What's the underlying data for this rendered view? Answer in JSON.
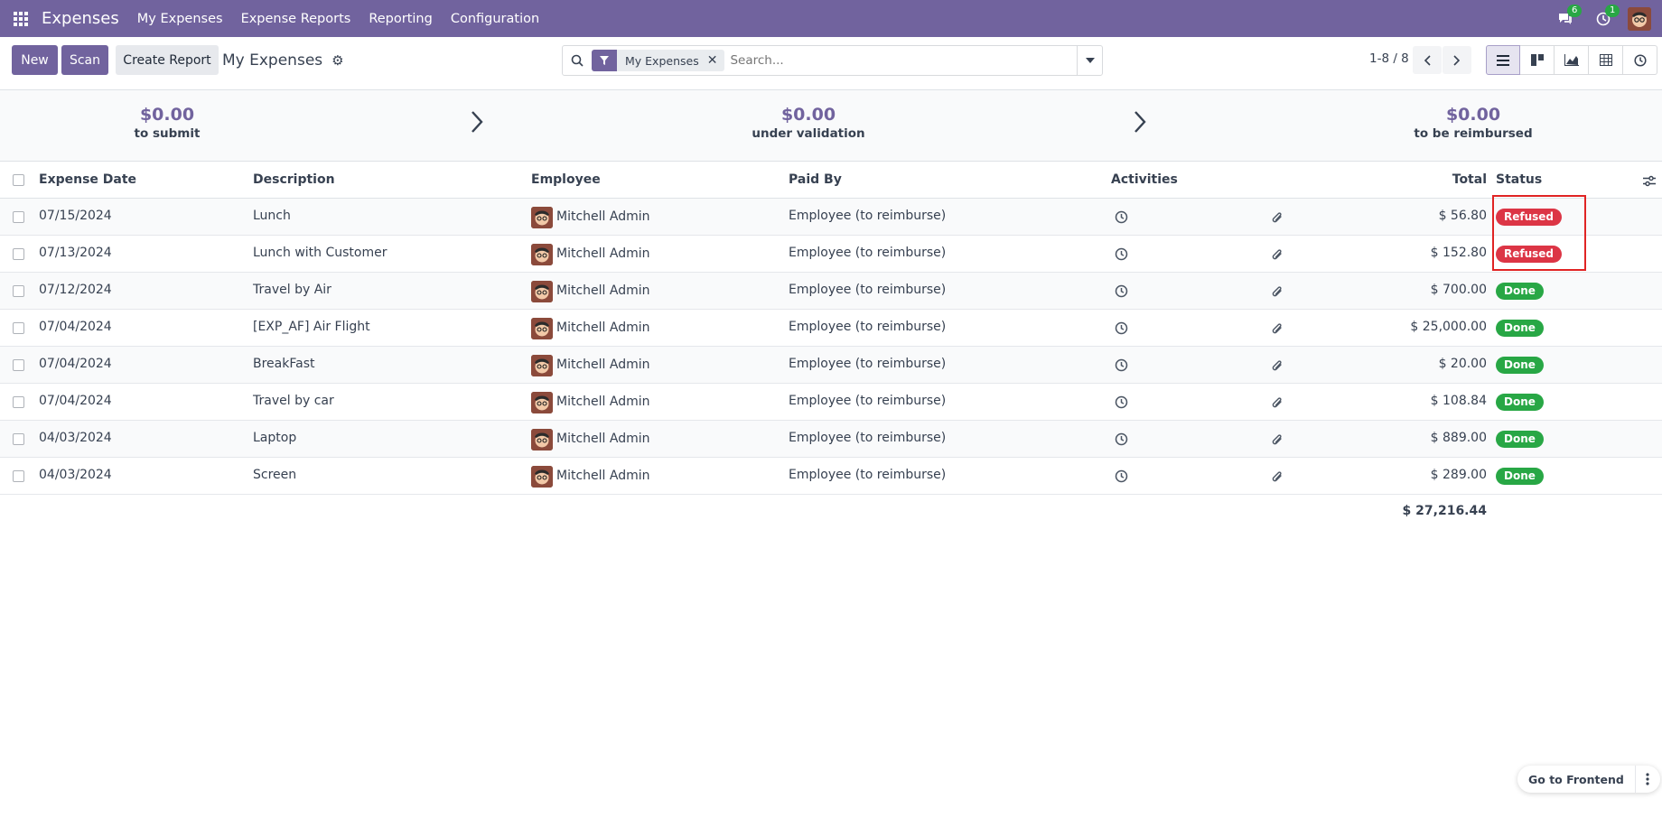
{
  "navbar": {
    "app_name": "Expenses",
    "menu": [
      "My Expenses",
      "Expense Reports",
      "Reporting",
      "Configuration"
    ],
    "messages_count": "6",
    "activities_count": "1"
  },
  "control": {
    "new_label": "New",
    "scan_label": "Scan",
    "create_report_label": "Create Report",
    "breadcrumb": "My Expenses",
    "facet_label": "My Expenses",
    "search_placeholder": "Search...",
    "pager": "1-8 / 8"
  },
  "summary": {
    "to_submit": {
      "amount": "$0.00",
      "label": "to submit"
    },
    "under_validation": {
      "amount": "$0.00",
      "label": "under validation"
    },
    "to_be_reimbursed": {
      "amount": "$0.00",
      "label": "to be reimbursed"
    }
  },
  "table": {
    "headers": {
      "date": "Expense Date",
      "description": "Description",
      "employee": "Employee",
      "paid_by": "Paid By",
      "activities": "Activities",
      "total": "Total",
      "status": "Status"
    },
    "rows": [
      {
        "date": "07/15/2024",
        "description": "Lunch",
        "employee": "Mitchell Admin",
        "paid_by": "Employee (to reimburse)",
        "total": "$ 56.80",
        "status": "Refused"
      },
      {
        "date": "07/13/2024",
        "description": "Lunch with Customer",
        "employee": "Mitchell Admin",
        "paid_by": "Employee (to reimburse)",
        "total": "$ 152.80",
        "status": "Refused"
      },
      {
        "date": "07/12/2024",
        "description": "Travel by Air",
        "employee": "Mitchell Admin",
        "paid_by": "Employee (to reimburse)",
        "total": "$ 700.00",
        "status": "Done"
      },
      {
        "date": "07/04/2024",
        "description": "[EXP_AF] Air Flight",
        "employee": "Mitchell Admin",
        "paid_by": "Employee (to reimburse)",
        "total": "$ 25,000.00",
        "status": "Done"
      },
      {
        "date": "07/04/2024",
        "description": "BreakFast",
        "employee": "Mitchell Admin",
        "paid_by": "Employee (to reimburse)",
        "total": "$ 20.00",
        "status": "Done"
      },
      {
        "date": "07/04/2024",
        "description": "Travel by car",
        "employee": "Mitchell Admin",
        "paid_by": "Employee (to reimburse)",
        "total": "$ 108.84",
        "status": "Done"
      },
      {
        "date": "04/03/2024",
        "description": "Laptop",
        "employee": "Mitchell Admin",
        "paid_by": "Employee (to reimburse)",
        "total": "$ 889.00",
        "status": "Done"
      },
      {
        "date": "04/03/2024",
        "description": "Screen",
        "employee": "Mitchell Admin",
        "paid_by": "Employee (to reimburse)",
        "total": "$ 289.00",
        "status": "Done"
      }
    ],
    "grand_total": "$ 27,216.44"
  },
  "status_colors": {
    "Refused": "#dc3545",
    "Done": "#28a745"
  },
  "floating": {
    "frontend_label": "Go to Frontend"
  }
}
